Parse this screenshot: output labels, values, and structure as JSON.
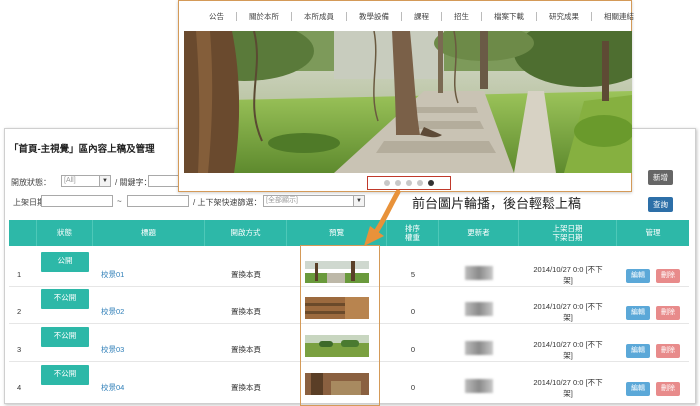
{
  "site": {
    "nav": [
      "公告",
      "關於本所",
      "本所成員",
      "教學設備",
      "課程",
      "招生",
      "檔案下載",
      "研究成果",
      "相關連結"
    ],
    "carousel_dots": 5,
    "carousel_active_index": 4
  },
  "caption": "前台圖片輪播，後台輕鬆上稿",
  "admin": {
    "title": "「首頁-主視覺」區內容上稿及管理",
    "filters": {
      "status_label": "開放狀態：",
      "status_value": "[All]",
      "keyword_label": "/ 關鍵字：",
      "date_label": "上架日期",
      "date_sep": "~",
      "quick_label": "/ 上下架快速篩選：",
      "quick_value": "[全部顯示]"
    },
    "buttons": {
      "new": "新增",
      "query": "查詢"
    },
    "columns": [
      "",
      "狀態",
      "標題",
      "開啟方式",
      "預覽",
      "排序\n權重",
      "更新者",
      "上架日期\n下架日期",
      "管理"
    ],
    "rows": [
      {
        "no": "1",
        "status": "公開",
        "title": "校景01",
        "open": "置換本頁",
        "order": "5",
        "date": "2014/10/27 0:0 [不下\n架]",
        "edit": "編輯",
        "delete": "刪除"
      },
      {
        "no": "2",
        "status": "不公開",
        "title": "校景02",
        "open": "置換本頁",
        "order": "0",
        "date": "2014/10/27 0:0 [不下\n架]",
        "edit": "編輯",
        "delete": "刪除"
      },
      {
        "no": "3",
        "status": "不公開",
        "title": "校景03",
        "open": "置換本頁",
        "order": "0",
        "date": "2014/10/27 0:0 [不下\n架]",
        "edit": "編輯",
        "delete": "刪除"
      },
      {
        "no": "4",
        "status": "不公開",
        "title": "校景04",
        "open": "置換本頁",
        "order": "0",
        "date": "2014/10/27 0:0 [不下\n架]",
        "edit": "編輯",
        "delete": "刪除"
      }
    ]
  },
  "colors": {
    "teal": "#2db8a8",
    "accent_border": "#d49a58",
    "dot_box": "#c0392b",
    "link": "#2f7fb8"
  }
}
